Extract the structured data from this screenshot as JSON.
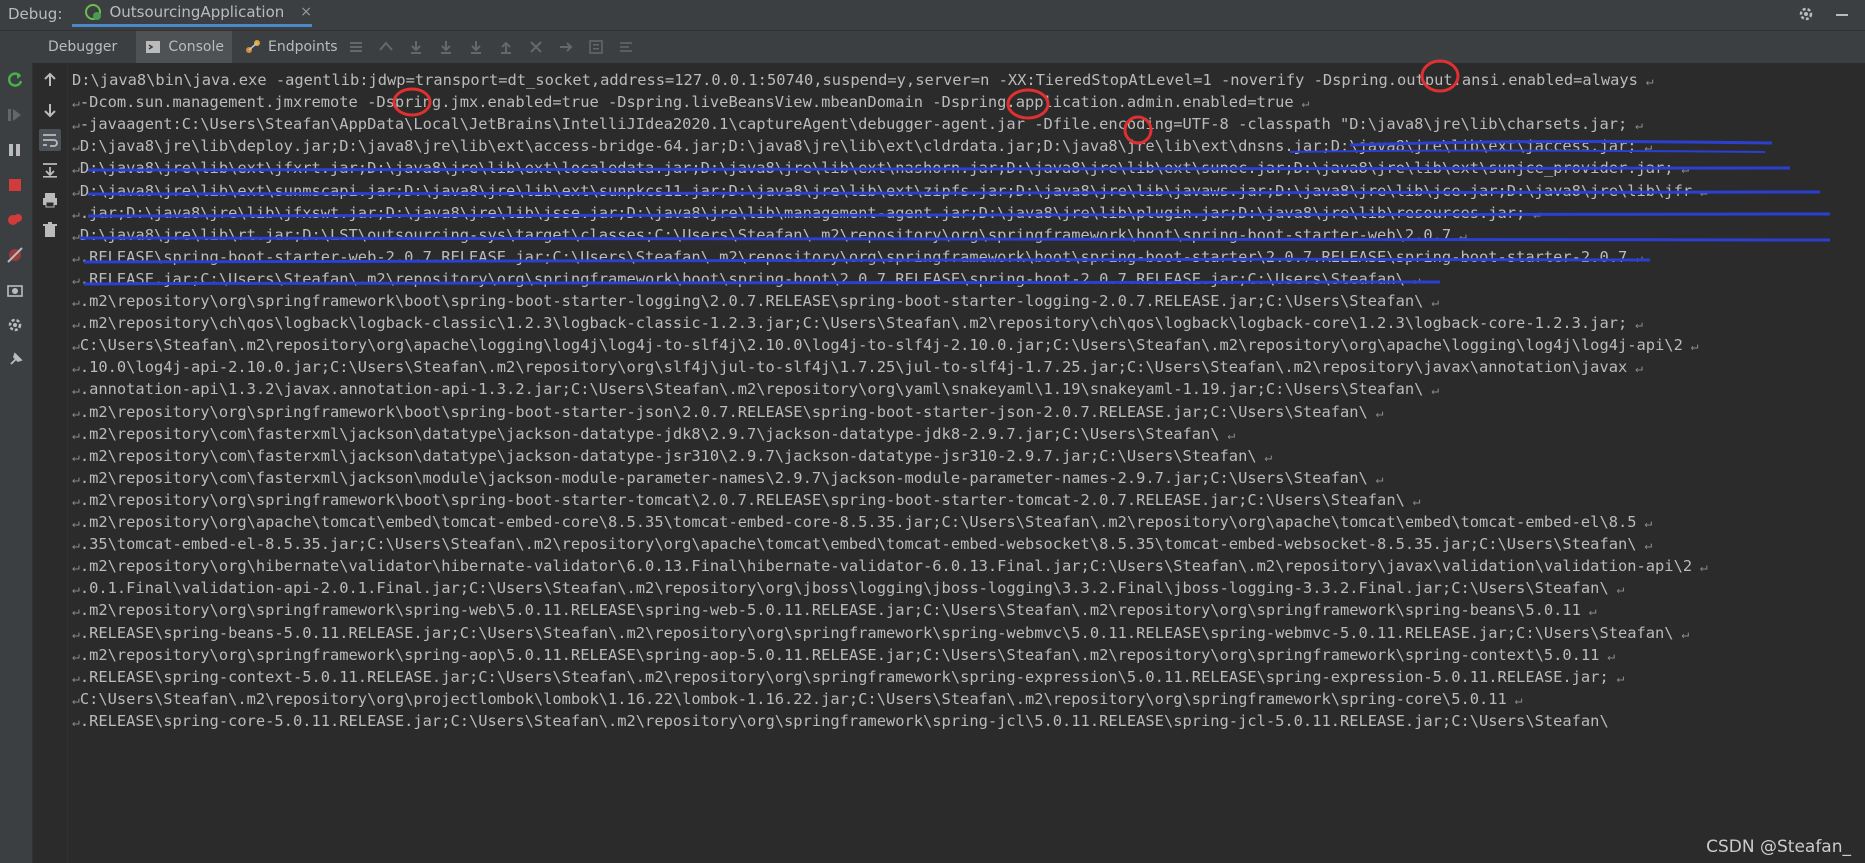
{
  "title_bar": {
    "debug_label": "Debug:",
    "run_config_name": "OutsourcingApplication",
    "close_glyph": "×"
  },
  "toolbar": {
    "tabs": [
      {
        "label": "Debugger",
        "icon": "none"
      },
      {
        "label": "Console",
        "icon": "console-icon"
      },
      {
        "label": "Endpoints",
        "icon": "endpoints-icon"
      }
    ]
  },
  "console": {
    "lines": [
      {
        "prefix": "",
        "text": "D:\\java8\\bin\\java.exe -agentlib:jdwp=transport=dt_socket,address=127.0.0.1:50740,suspend=y,server=n -XX:TieredStopAtLevel=1 -noverify -Dspring.output.ansi.enabled=always",
        "wrap": true
      },
      {
        "prefix": "↵",
        "text": "-Dcom.sun.management.jmxremote -Dspring.jmx.enabled=true -Dspring.liveBeansView.mbeanDomain -Dspring.application.admin.enabled=true",
        "wrap": true
      },
      {
        "prefix": "↵",
        "text": "-javaagent:C:\\Users\\Steafan\\AppData\\Local\\JetBrains\\IntelliJIdea2020.1\\captureAgent\\debugger-agent.jar -Dfile.encoding=UTF-8 -classpath \"D:\\java8\\jre\\lib\\charsets.jar;",
        "wrap": true
      },
      {
        "prefix": "↵",
        "text": "D:\\java8\\jre\\lib\\deploy.jar;D:\\java8\\jre\\lib\\ext\\access-bridge-64.jar;D:\\java8\\jre\\lib\\ext\\cldrdata.jar;D:\\java8\\jre\\lib\\ext\\dnsns.jar;D:\\java8\\jre\\lib\\ext\\jaccess.jar;",
        "wrap": true
      },
      {
        "prefix": "↵",
        "text": "D:\\java8\\jre\\lib\\ext\\jfxrt.jar;D:\\java8\\jre\\lib\\ext\\localedata.jar;D:\\java8\\jre\\lib\\ext\\nashorn.jar;D:\\java8\\jre\\lib\\ext\\sunec.jar;D:\\java8\\jre\\lib\\ext\\sunjce_provider.jar;",
        "wrap": true
      },
      {
        "prefix": "↵",
        "text": "D:\\java8\\jre\\lib\\ext\\sunmscapi.jar;D:\\java8\\jre\\lib\\ext\\sunpkcs11.jar;D:\\java8\\jre\\lib\\ext\\zipfs.jar;D:\\java8\\jre\\lib\\javaws.jar;D:\\java8\\jre\\lib\\jce.jar;D:\\java8\\jre\\lib\\jfr",
        "wrap": true
      },
      {
        "prefix": "↵",
        "text": ".jar;D:\\java8\\jre\\lib\\jfxswt.jar;D:\\java8\\jre\\lib\\jsse.jar;D:\\java8\\jre\\lib\\management-agent.jar;D:\\java8\\jre\\lib\\plugin.jar;D:\\java8\\jre\\lib\\resources.jar;",
        "wrap": true
      },
      {
        "prefix": "↵",
        "text": "D:\\java8\\jre\\lib\\rt.jar;D:\\LST\\outsourcing-sys\\target\\classes;C:\\Users\\Steafan\\.m2\\repository\\org\\springframework\\boot\\spring-boot-starter-web\\2.0.7",
        "wrap": true
      },
      {
        "prefix": "↵",
        "text": ".RELEASE\\spring-boot-starter-web-2.0.7.RELEASE.jar;C:\\Users\\Steafan\\.m2\\repository\\org\\springframework\\boot\\spring-boot-starter\\2.0.7.RELEASE\\spring-boot-starter-2.0.7",
        "wrap": true
      },
      {
        "prefix": "↵",
        "text": ".RELEASE.jar;C:\\Users\\Steafan\\.m2\\repository\\org\\springframework\\boot\\spring-boot\\2.0.7.RELEASE\\spring-boot-2.0.7.RELEASE.jar;C:\\Users\\Steafan\\",
        "wrap": true
      },
      {
        "prefix": "↵",
        "text": ".m2\\repository\\org\\springframework\\boot\\spring-boot-starter-logging\\2.0.7.RELEASE\\spring-boot-starter-logging-2.0.7.RELEASE.jar;C:\\Users\\Steafan\\",
        "wrap": true
      },
      {
        "prefix": "↵",
        "text": ".m2\\repository\\ch\\qos\\logback\\logback-classic\\1.2.3\\logback-classic-1.2.3.jar;C:\\Users\\Steafan\\.m2\\repository\\ch\\qos\\logback\\logback-core\\1.2.3\\logback-core-1.2.3.jar;",
        "wrap": true
      },
      {
        "prefix": "↵",
        "text": "C:\\Users\\Steafan\\.m2\\repository\\org\\apache\\logging\\log4j\\log4j-to-slf4j\\2.10.0\\log4j-to-slf4j-2.10.0.jar;C:\\Users\\Steafan\\.m2\\repository\\org\\apache\\logging\\log4j\\log4j-api\\2",
        "wrap": true
      },
      {
        "prefix": "↵",
        "text": ".10.0\\log4j-api-2.10.0.jar;C:\\Users\\Steafan\\.m2\\repository\\org\\slf4j\\jul-to-slf4j\\1.7.25\\jul-to-slf4j-1.7.25.jar;C:\\Users\\Steafan\\.m2\\repository\\javax\\annotation\\javax",
        "wrap": true
      },
      {
        "prefix": "↵",
        "text": ".annotation-api\\1.3.2\\javax.annotation-api-1.3.2.jar;C:\\Users\\Steafan\\.m2\\repository\\org\\yaml\\snakeyaml\\1.19\\snakeyaml-1.19.jar;C:\\Users\\Steafan\\",
        "wrap": true
      },
      {
        "prefix": "↵",
        "text": ".m2\\repository\\org\\springframework\\boot\\spring-boot-starter-json\\2.0.7.RELEASE\\spring-boot-starter-json-2.0.7.RELEASE.jar;C:\\Users\\Steafan\\",
        "wrap": true
      },
      {
        "prefix": "↵",
        "text": ".m2\\repository\\com\\fasterxml\\jackson\\datatype\\jackson-datatype-jdk8\\2.9.7\\jackson-datatype-jdk8-2.9.7.jar;C:\\Users\\Steafan\\",
        "wrap": true
      },
      {
        "prefix": "↵",
        "text": ".m2\\repository\\com\\fasterxml\\jackson\\datatype\\jackson-datatype-jsr310\\2.9.7\\jackson-datatype-jsr310-2.9.7.jar;C:\\Users\\Steafan\\",
        "wrap": true
      },
      {
        "prefix": "↵",
        "text": ".m2\\repository\\com\\fasterxml\\jackson\\module\\jackson-module-parameter-names\\2.9.7\\jackson-module-parameter-names-2.9.7.jar;C:\\Users\\Steafan\\",
        "wrap": true
      },
      {
        "prefix": "↵",
        "text": ".m2\\repository\\org\\springframework\\boot\\spring-boot-starter-tomcat\\2.0.7.RELEASE\\spring-boot-starter-tomcat-2.0.7.RELEASE.jar;C:\\Users\\Steafan\\",
        "wrap": true
      },
      {
        "prefix": "↵",
        "text": ".m2\\repository\\org\\apache\\tomcat\\embed\\tomcat-embed-core\\8.5.35\\tomcat-embed-core-8.5.35.jar;C:\\Users\\Steafan\\.m2\\repository\\org\\apache\\tomcat\\embed\\tomcat-embed-el\\8.5",
        "wrap": true
      },
      {
        "prefix": "↵",
        "text": ".35\\tomcat-embed-el-8.5.35.jar;C:\\Users\\Steafan\\.m2\\repository\\org\\apache\\tomcat\\embed\\tomcat-embed-websocket\\8.5.35\\tomcat-embed-websocket-8.5.35.jar;C:\\Users\\Steafan\\",
        "wrap": true
      },
      {
        "prefix": "↵",
        "text": ".m2\\repository\\org\\hibernate\\validator\\hibernate-validator\\6.0.13.Final\\hibernate-validator-6.0.13.Final.jar;C:\\Users\\Steafan\\.m2\\repository\\javax\\validation\\validation-api\\2",
        "wrap": true
      },
      {
        "prefix": "↵",
        "text": ".0.1.Final\\validation-api-2.0.1.Final.jar;C:\\Users\\Steafan\\.m2\\repository\\org\\jboss\\logging\\jboss-logging\\3.3.2.Final\\jboss-logging-3.3.2.Final.jar;C:\\Users\\Steafan\\",
        "wrap": true
      },
      {
        "prefix": "↵",
        "text": ".m2\\repository\\org\\springframework\\spring-web\\5.0.11.RELEASE\\spring-web-5.0.11.RELEASE.jar;C:\\Users\\Steafan\\.m2\\repository\\org\\springframework\\spring-beans\\5.0.11",
        "wrap": true
      },
      {
        "prefix": "↵",
        "text": ".RELEASE\\spring-beans-5.0.11.RELEASE.jar;C:\\Users\\Steafan\\.m2\\repository\\org\\springframework\\spring-webmvc\\5.0.11.RELEASE\\spring-webmvc-5.0.11.RELEASE.jar;C:\\Users\\Steafan\\",
        "wrap": true
      },
      {
        "prefix": "↵",
        "text": ".m2\\repository\\org\\springframework\\spring-aop\\5.0.11.RELEASE\\spring-aop-5.0.11.RELEASE.jar;C:\\Users\\Steafan\\.m2\\repository\\org\\springframework\\spring-context\\5.0.11",
        "wrap": true
      },
      {
        "prefix": "↵",
        "text": ".RELEASE\\spring-context-5.0.11.RELEASE.jar;C:\\Users\\Steafan\\.m2\\repository\\org\\springframework\\spring-expression\\5.0.11.RELEASE\\spring-expression-5.0.11.RELEASE.jar;",
        "wrap": true
      },
      {
        "prefix": "↵",
        "text": "C:\\Users\\Steafan\\.m2\\repository\\org\\projectlombok\\lombok\\1.16.22\\lombok-1.16.22.jar;C:\\Users\\Steafan\\.m2\\repository\\org\\springframework\\spring-core\\5.0.11",
        "wrap": true
      },
      {
        "prefix": "↵",
        "text": ".RELEASE\\spring-core-5.0.11.RELEASE.jar;C:\\Users\\Steafan\\.m2\\repository\\org\\springframework\\spring-jcl\\5.0.11.RELEASE\\spring-jcl-5.0.11.RELEASE.jar;C:\\Users\\Steafan\\",
        "wrap": false
      }
    ]
  },
  "watermark": "CSDN @Steafan_",
  "colors": {
    "background": "#2b2b2b",
    "panel": "#3c3f41",
    "text": "#bbbbbb",
    "tab_underline": "#4a88c7",
    "annotation_red": "#e03030",
    "annotation_blue": "#2b3fd0",
    "restart_green": "#49b04a",
    "stop_red": "#d23b3b"
  }
}
